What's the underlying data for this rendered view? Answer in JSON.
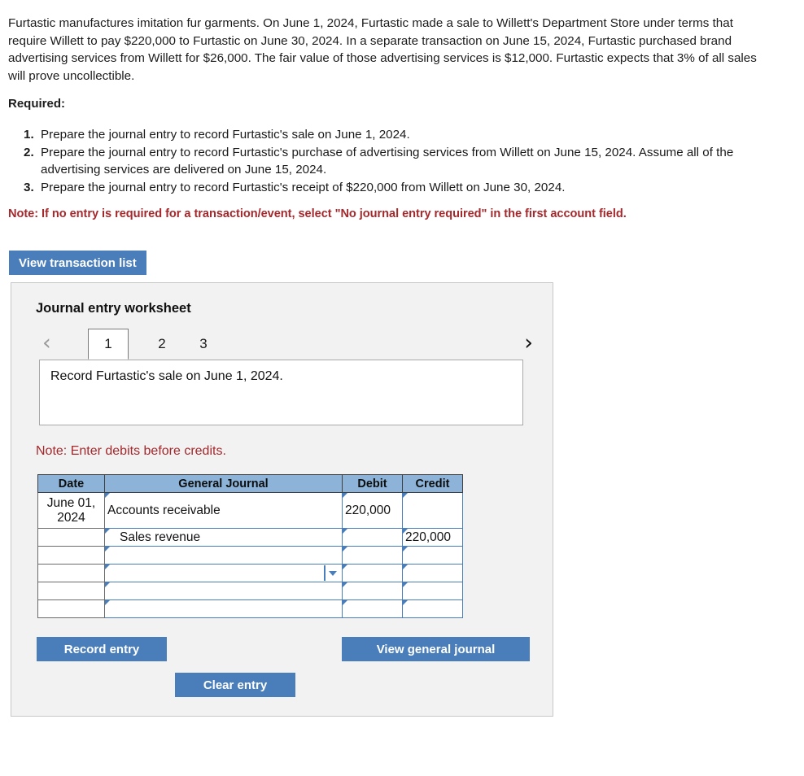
{
  "problem": {
    "text": "Furtastic manufactures imitation fur garments. On June 1, 2024, Furtastic made a sale to Willett's Department Store under terms that require Willett to pay $220,000 to Furtastic on June 30, 2024. In a separate transaction on June 15, 2024, Furtastic purchased brand advertising services from Willett for $26,000. The fair value of those advertising services is $12,000. Furtastic expects that 3% of all sales will prove uncollectible."
  },
  "required": {
    "label": "Required:",
    "items": [
      {
        "num": "1.",
        "text": "Prepare the journal entry to record Furtastic's sale on June 1, 2024."
      },
      {
        "num": "2.",
        "text": "Prepare the journal entry to record Furtastic's purchase of advertising services from Willett on June 15, 2024. Assume all of the advertising services are delivered on June 15, 2024."
      },
      {
        "num": "3.",
        "text": "Prepare the journal entry to record Furtastic's receipt of $220,000 from Willett on June 30, 2024."
      }
    ]
  },
  "notes": {
    "no_entry_note": "Note: If no entry is required for a transaction/event, select \"No journal entry required\" in the first account field.",
    "debits_note": "Note: Enter debits before credits."
  },
  "toolbar": {
    "view_transaction_list": "View transaction list"
  },
  "worksheet": {
    "title": "Journal entry worksheet",
    "prev_arrow": "‹",
    "next_arrow": "›",
    "tabs": [
      {
        "label": "1",
        "active": true
      },
      {
        "label": "2",
        "active": false
      },
      {
        "label": "3",
        "active": false
      }
    ],
    "description": "Record Furtastic's sale on June 1, 2024.",
    "table": {
      "headers": [
        "Date",
        "General Journal",
        "Debit",
        "Credit"
      ],
      "rows": [
        {
          "date": "June 01, 2024",
          "account": "Accounts receivable",
          "indent": false,
          "debit": "220,000",
          "credit": "",
          "dropdown": false
        },
        {
          "date": "",
          "account": "Sales revenue",
          "indent": true,
          "debit": "",
          "credit": "220,000",
          "dropdown": false
        },
        {
          "date": "",
          "account": "",
          "indent": false,
          "debit": "",
          "credit": "",
          "dropdown": false
        },
        {
          "date": "",
          "account": "",
          "indent": false,
          "debit": "",
          "credit": "",
          "dropdown": true
        },
        {
          "date": "",
          "account": "",
          "indent": false,
          "debit": "",
          "credit": "",
          "dropdown": false
        },
        {
          "date": "",
          "account": "",
          "indent": false,
          "debit": "",
          "credit": "",
          "dropdown": false
        }
      ]
    },
    "buttons": {
      "record_entry": "Record entry",
      "clear_entry": "Clear entry",
      "view_general_journal": "View general journal"
    }
  },
  "colors": {
    "button_blue": "#4a7ebb",
    "header_blue": "#8db4d8",
    "note_red": "#a5282c",
    "panel_gray": "#f2f2f2"
  }
}
